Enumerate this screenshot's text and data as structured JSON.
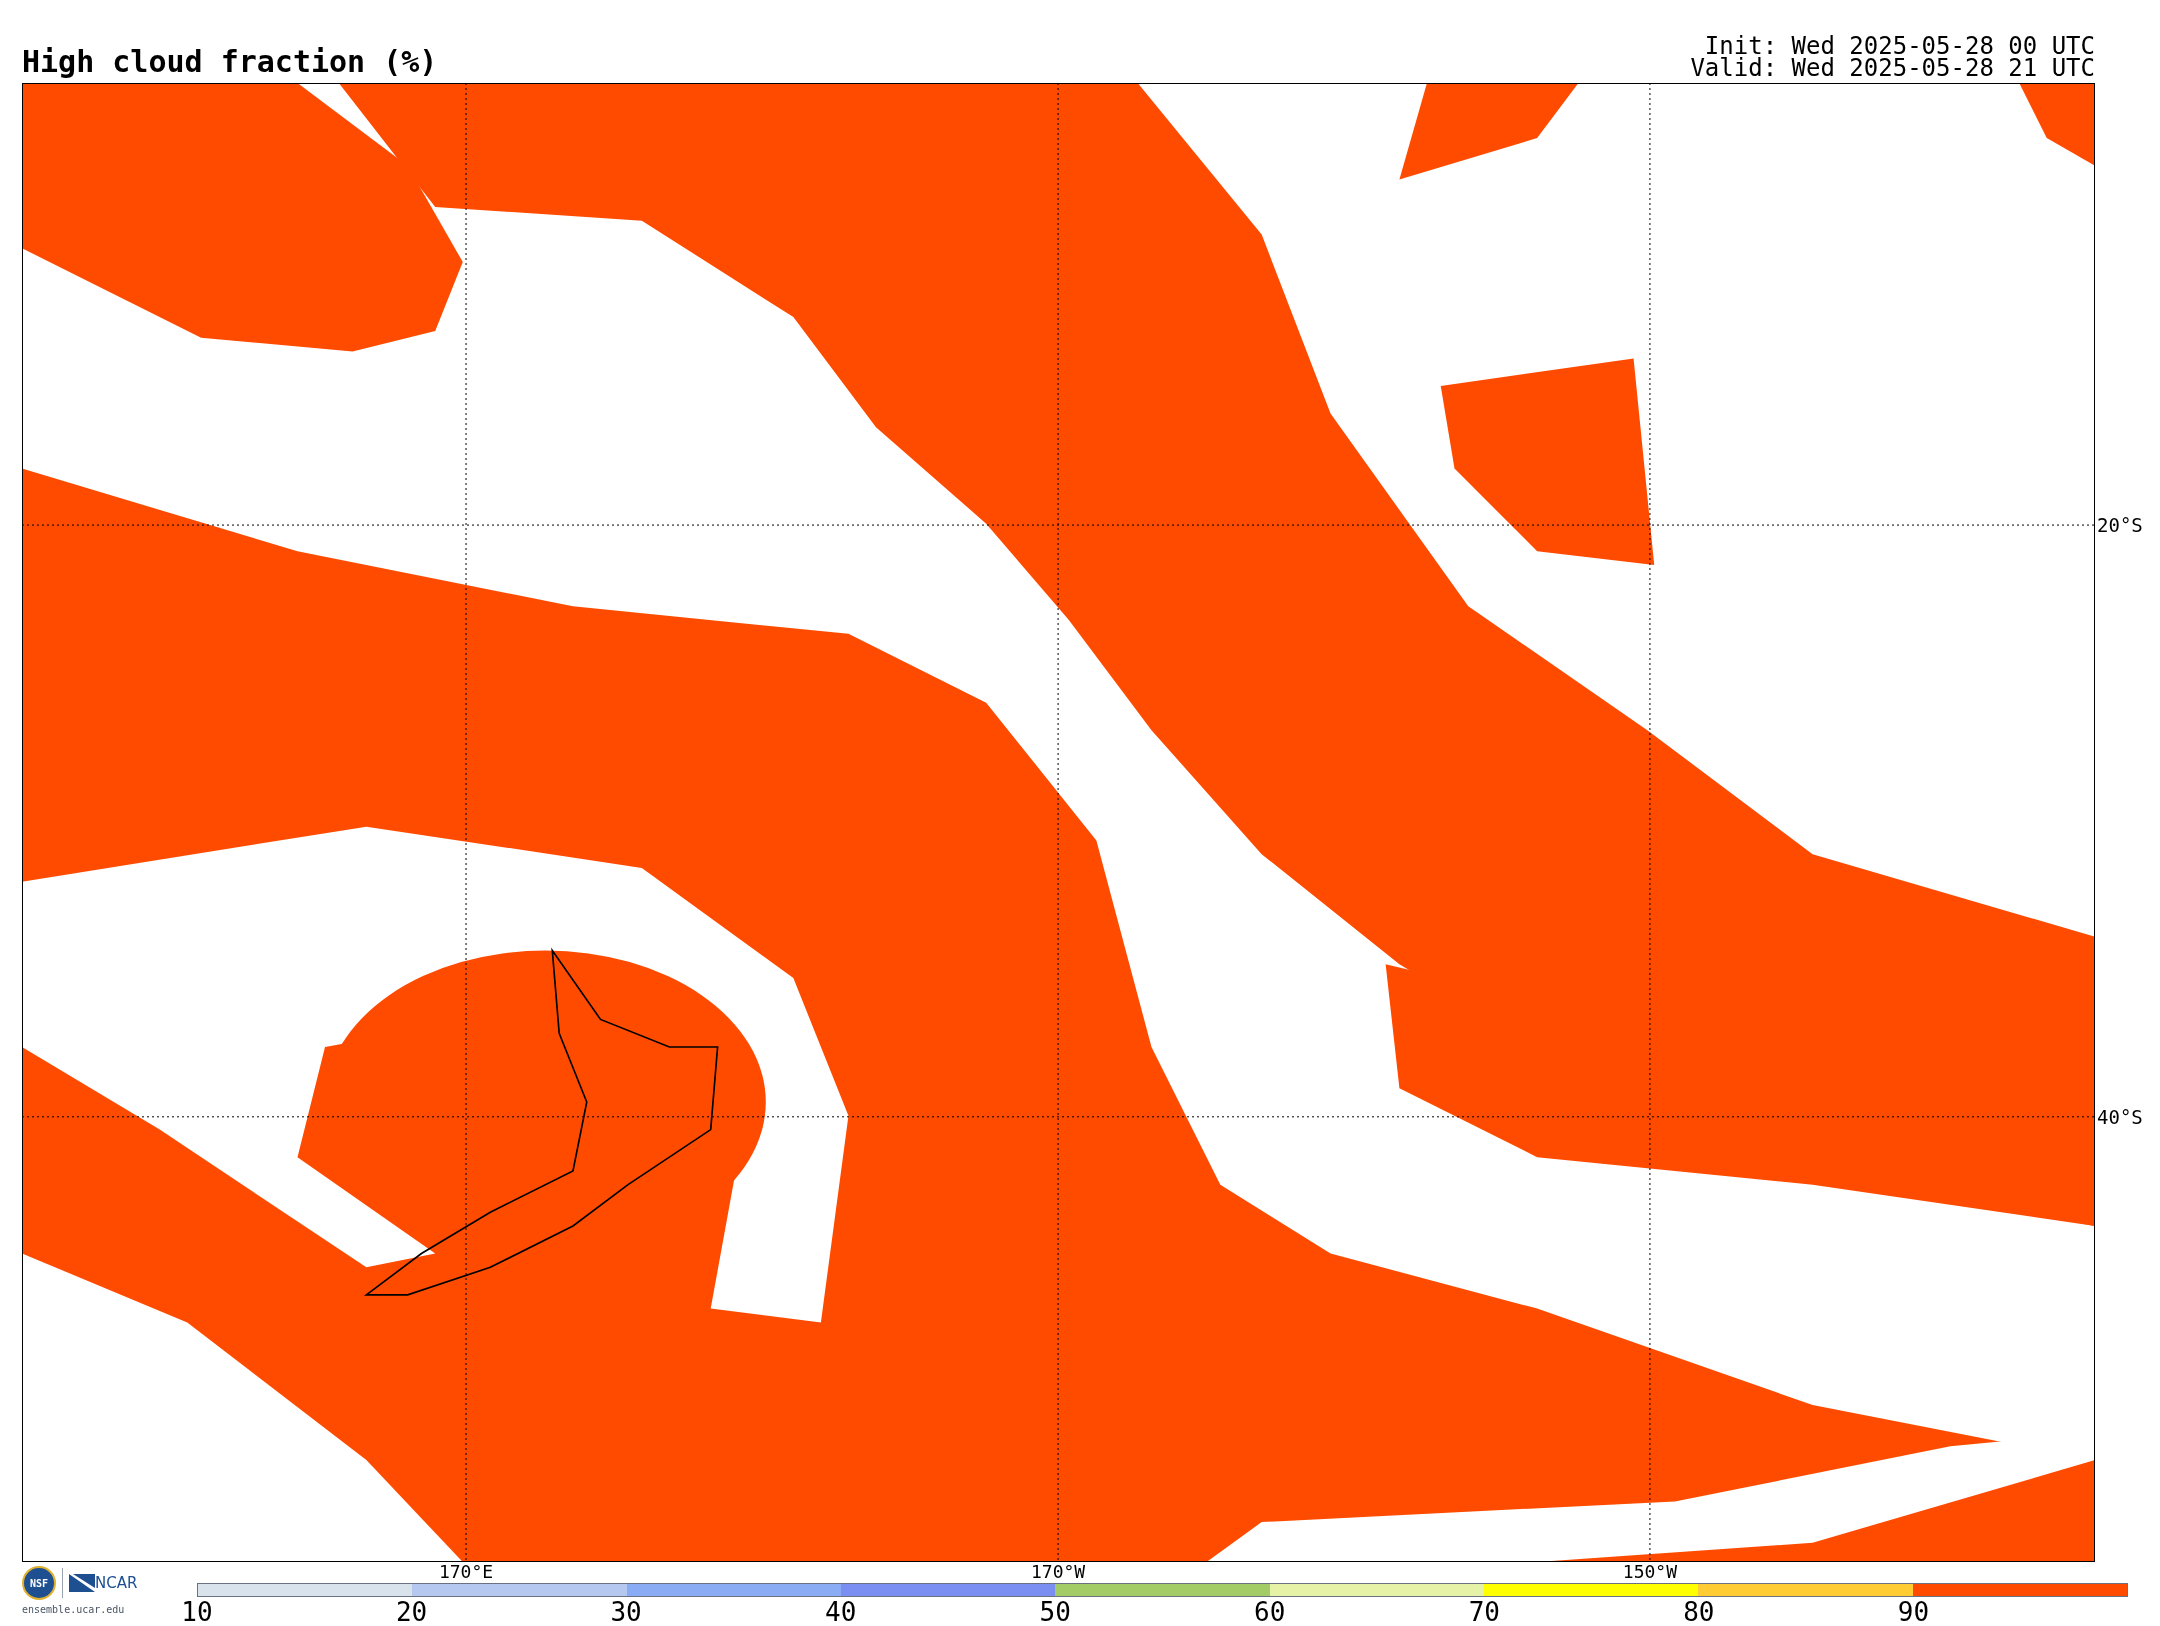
{
  "title": "High cloud fraction (%)",
  "init": "Init: Wed 2025-05-28 00 UTC",
  "valid": "Valid: Wed 2025-05-28 21 UTC",
  "map": {
    "longitude_labels": [
      "170°E",
      "170°W",
      "150°W"
    ],
    "latitude_labels": [
      "20°S",
      "40°S"
    ]
  },
  "logo": {
    "emblem": "NSF",
    "org": "NCAR",
    "url": "ensemble.ucar.edu"
  },
  "colorbar": {
    "segments": [
      {
        "color": "#d9e3ec"
      },
      {
        "color": "#b4c8f0"
      },
      {
        "color": "#8aacf5"
      },
      {
        "color": "#7b8ff2"
      },
      {
        "color": "#a3cc66"
      },
      {
        "color": "#e6f2a6"
      },
      {
        "color": "#ffff00"
      },
      {
        "color": "#ffcc33"
      },
      {
        "color": "#ff4b00"
      }
    ],
    "ticks": [
      "10",
      "20",
      "30",
      "40",
      "50",
      "60",
      "70",
      "80",
      "90"
    ]
  }
}
